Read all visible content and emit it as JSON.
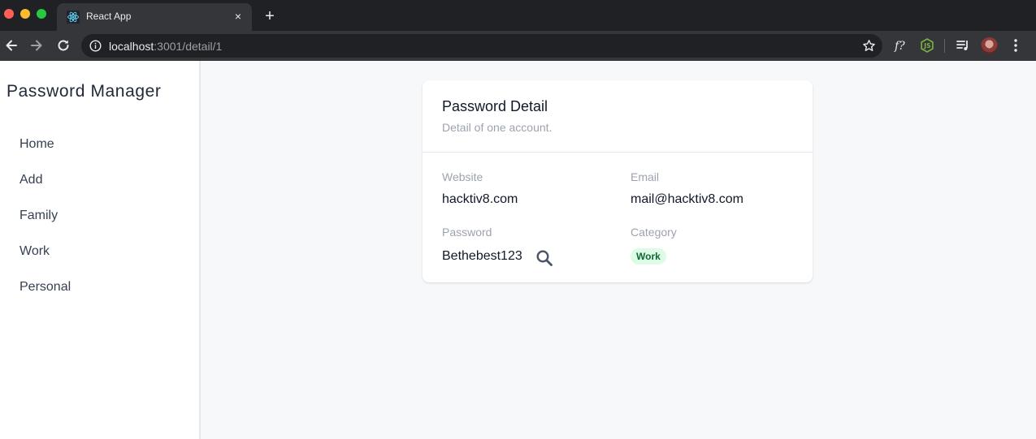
{
  "browser": {
    "tab_title": "React App",
    "tab_close": "×",
    "new_tab": "+",
    "url_host": "localhost",
    "url_path": ":3001/detail/1"
  },
  "sidebar": {
    "title": "Password Manager",
    "items": [
      {
        "label": "Home"
      },
      {
        "label": "Add"
      },
      {
        "label": "Family"
      },
      {
        "label": "Work"
      },
      {
        "label": "Personal"
      }
    ]
  },
  "detail": {
    "title": "Password Detail",
    "subtitle": "Detail of one account.",
    "website_label": "Website",
    "website_value": "hacktiv8.com",
    "email_label": "Email",
    "email_value": "mail@hacktiv8.com",
    "password_label": "Password",
    "password_value": "Bethebest123",
    "category_label": "Category",
    "category_value": "Work"
  },
  "icons": {
    "reveal_password": "search-icon"
  },
  "colors": {
    "badge_bg": "#dcfce7",
    "badge_text": "#166534",
    "chrome_dark": "#202124"
  }
}
